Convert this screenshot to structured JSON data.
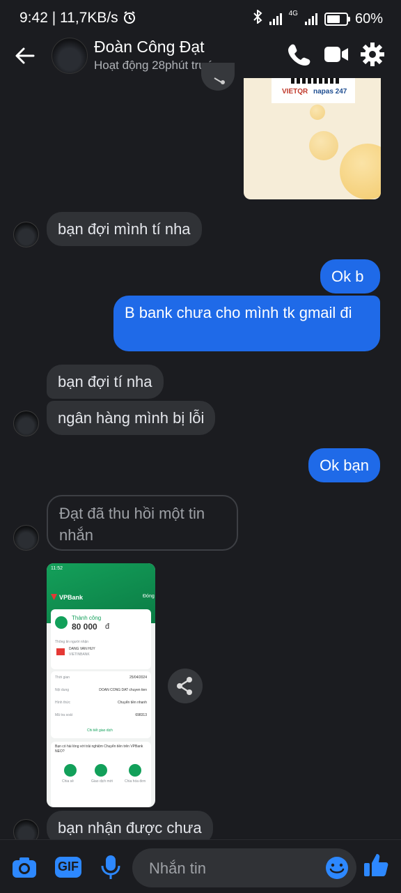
{
  "status_bar": {
    "time": "9:42",
    "speed": "11,7KB/s",
    "network": "4G",
    "battery": "60%"
  },
  "header": {
    "contact_name": "Đoàn Công Đạt",
    "presence": "Hoạt động 28phút trước"
  },
  "qr_card": {
    "logo_left": "VIETQR",
    "logo_right": "napas 247"
  },
  "messages": [
    {
      "id": "m1",
      "dir": "in",
      "text": "bạn đợi mình tí nha"
    },
    {
      "id": "m2",
      "dir": "out",
      "text": "Ok b"
    },
    {
      "id": "m3",
      "dir": "out",
      "text": "B bank chưa cho mình tk gmail đi"
    },
    {
      "id": "m4",
      "dir": "in",
      "text": "bạn đợi tí nha"
    },
    {
      "id": "m5",
      "dir": "in",
      "text": "ngân hàng mình bị lỗi"
    },
    {
      "id": "m6",
      "dir": "out",
      "text": "Ok bạn"
    },
    {
      "id": "m7",
      "dir": "in",
      "text": "Đạt đã thu hồi một tin nhắn",
      "recalled": true
    },
    {
      "id": "m8",
      "dir": "in",
      "text": "bạn nhận được chưa"
    }
  ],
  "receipt": {
    "time": "11:52",
    "bank": "VPBank",
    "close": "Đóng",
    "status": "Thành công",
    "amount": "80 000",
    "currency": "đ",
    "recipient_label": "Thông tin người nhận",
    "recipient_name": "DANG VAN HUY",
    "recipient_account": "VIETINBANK",
    "date_label": "Thời gian",
    "date": "25/04/2024",
    "content_label": "Nội dung",
    "content": "DOAN CONG DAT chuyen tien",
    "method_label": "Hình thức",
    "method": "Chuyển tiền nhanh",
    "ref_label": "Mã tra soát",
    "ref": "698313",
    "detail_link": "Chi tiết giao dịch",
    "survey": "Bạn có hài lòng với trải nghiệm Chuyển tiền trên VPBank NEO?",
    "actions": [
      "Chia sẻ",
      "Giao dịch mới",
      "Chia hóa đơn"
    ]
  },
  "composer": {
    "placeholder": "Nhắn tin",
    "gif_label": "GIF"
  },
  "colors": {
    "background": "#1b1c20",
    "outgoing_bubble": "#1f6ae8",
    "incoming_bubble": "#303236",
    "accent_icon": "#2d88ff"
  },
  "icons": [
    "back-arrow-icon",
    "phone-icon",
    "video-camera-icon",
    "gear-icon",
    "share-icon",
    "camera-icon",
    "gif-icon",
    "microphone-icon",
    "emoji-icon",
    "thumbs-up-icon"
  ]
}
